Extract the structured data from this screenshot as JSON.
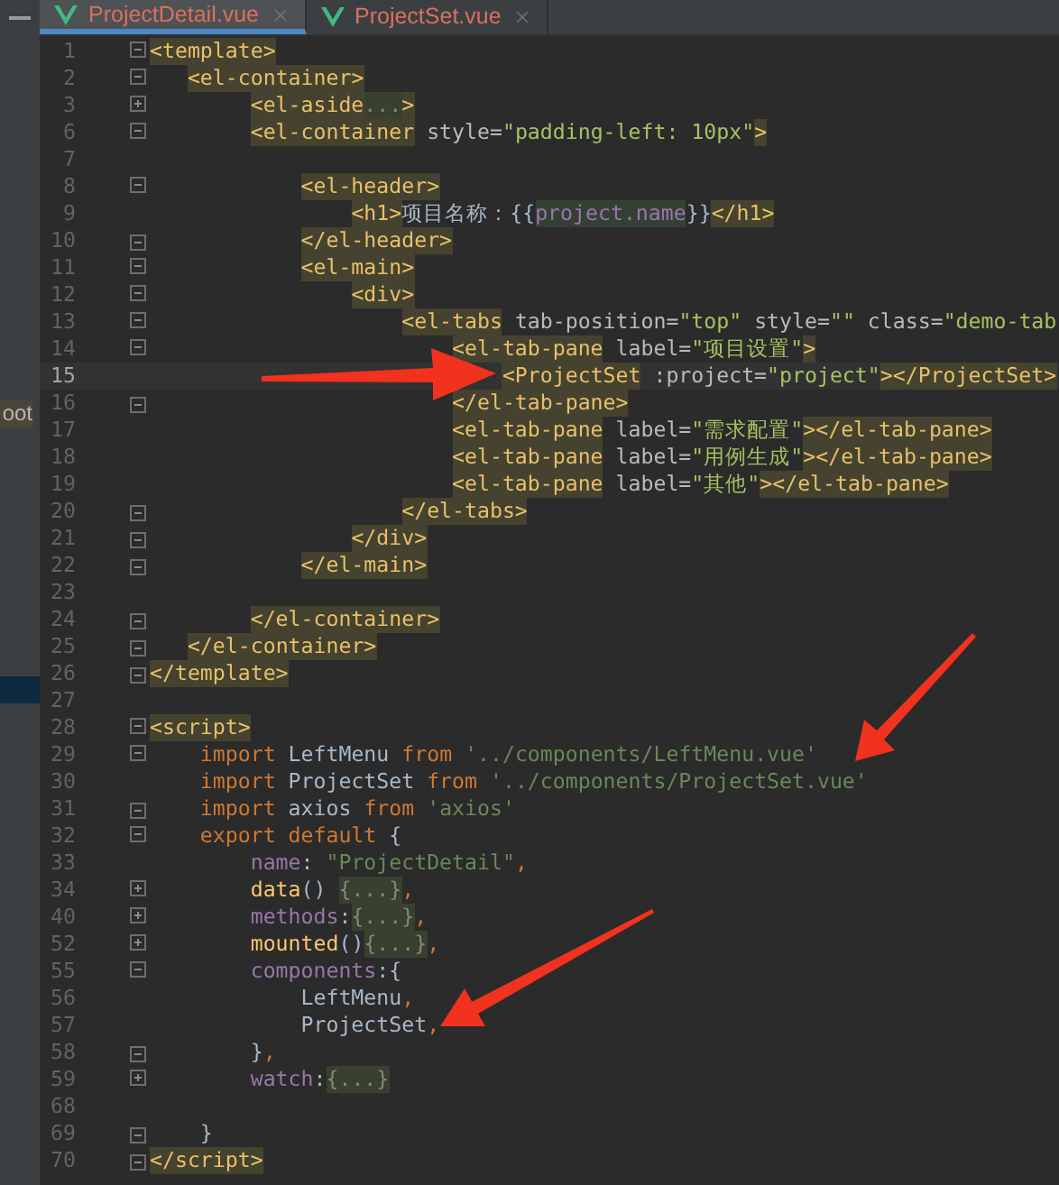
{
  "side_panel": {
    "label": "oot"
  },
  "tabs": [
    {
      "label": "ProjectDetail.vue",
      "selected": true
    },
    {
      "label": "ProjectSet.vue",
      "selected": false
    }
  ],
  "lines": [
    {
      "number": "1",
      "current": false,
      "fold": {
        "collapsed": false,
        "end": false
      },
      "tokens": [
        {
          "text": "<template>",
          "kind": "tag"
        }
      ]
    },
    {
      "number": "2",
      "current": false,
      "fold": {
        "collapsed": false,
        "end": false
      },
      "tokens": [
        {
          "text": "   <el-container>",
          "kind": "tag"
        }
      ]
    },
    {
      "number": "3",
      "current": false,
      "fold": {
        "collapsed": true,
        "end": false
      },
      "tokens": [
        {
          "text": "        <el-aside",
          "kind": "tag"
        },
        {
          "text": "...",
          "kind": "fold"
        },
        {
          "text": ">",
          "kind": "tag"
        }
      ]
    },
    {
      "number": "6",
      "current": false,
      "fold": {
        "collapsed": false,
        "end": false
      },
      "tokens": [
        {
          "text": "        <el-container",
          "kind": "tag"
        },
        {
          "text": " style=",
          "kind": "attr"
        },
        {
          "text": "\"padding-left: 10px\"",
          "kind": "string"
        },
        {
          "text": ">",
          "kind": "tag"
        }
      ]
    },
    {
      "number": "7",
      "current": false
    },
    {
      "number": "8",
      "current": false,
      "fold": {
        "collapsed": false,
        "end": false
      },
      "tokens": [
        {
          "text": "            <el-header>",
          "kind": "tag"
        }
      ]
    },
    {
      "number": "9",
      "current": false,
      "tokens": [
        {
          "text": "                <h1>",
          "kind": "tag"
        },
        {
          "text": "项目名称：{{",
          "kind": "plain"
        },
        {
          "text": "project.name",
          "kind": "var"
        },
        {
          "text": "}}",
          "kind": "plain"
        },
        {
          "text": "</h1>",
          "kind": "tag"
        }
      ]
    },
    {
      "number": "10",
      "current": false,
      "fold": {
        "collapsed": false,
        "end": true
      },
      "tokens": [
        {
          "text": "            </el-header>",
          "kind": "tag"
        }
      ]
    },
    {
      "number": "11",
      "current": false,
      "fold": {
        "collapsed": false,
        "end": false
      },
      "tokens": [
        {
          "text": "            <el-main>",
          "kind": "tag"
        }
      ]
    },
    {
      "number": "12",
      "current": false,
      "fold": {
        "collapsed": false,
        "end": false
      },
      "tokens": [
        {
          "text": "                <div>",
          "kind": "tag"
        }
      ]
    },
    {
      "number": "13",
      "current": false,
      "fold": {
        "collapsed": false,
        "end": false
      },
      "tokens": [
        {
          "text": "                    <el-tabs",
          "kind": "tag"
        },
        {
          "text": " tab-position=",
          "kind": "attr"
        },
        {
          "text": "\"top\"",
          "kind": "string"
        },
        {
          "text": " style=",
          "kind": "attr"
        },
        {
          "text": "\"\"",
          "kind": "string"
        },
        {
          "text": " class=",
          "kind": "attr"
        },
        {
          "text": "\"demo-tab",
          "kind": "string"
        }
      ]
    },
    {
      "number": "14",
      "current": false,
      "fold": {
        "collapsed": false,
        "end": false
      },
      "tokens": [
        {
          "text": "                        <el-tab-pane",
          "kind": "tag"
        },
        {
          "text": " label=",
          "kind": "attr"
        },
        {
          "text": "\"项目设置\"",
          "kind": "string"
        },
        {
          "text": ">",
          "kind": "tag"
        }
      ]
    },
    {
      "number": "15",
      "current": true,
      "tokens": [
        {
          "text": "                            <ProjectSet",
          "kind": "tag"
        },
        {
          "text": " :project=",
          "kind": "attr"
        },
        {
          "text": "\"project\"",
          "kind": "string"
        },
        {
          "text": "></ProjectSet>",
          "kind": "tag"
        }
      ]
    },
    {
      "number": "16",
      "current": false,
      "fold": {
        "collapsed": false,
        "end": true
      },
      "tokens": [
        {
          "text": "                        </el-tab-pane>",
          "kind": "tag"
        }
      ]
    },
    {
      "number": "17",
      "current": false,
      "tokens": [
        {
          "text": "                        <el-tab-pane",
          "kind": "tag"
        },
        {
          "text": " label=",
          "kind": "attr"
        },
        {
          "text": "\"需求配置\"",
          "kind": "string"
        },
        {
          "text": "></el-tab-pane>",
          "kind": "tag"
        }
      ]
    },
    {
      "number": "18",
      "current": false,
      "tokens": [
        {
          "text": "                        <el-tab-pane",
          "kind": "tag"
        },
        {
          "text": " label=",
          "kind": "attr"
        },
        {
          "text": "\"用例生成\"",
          "kind": "string"
        },
        {
          "text": "></el-tab-pane>",
          "kind": "tag"
        }
      ]
    },
    {
      "number": "19",
      "current": false,
      "tokens": [
        {
          "text": "                        <el-tab-pane",
          "kind": "tag"
        },
        {
          "text": " label=",
          "kind": "attr"
        },
        {
          "text": "\"其他\"",
          "kind": "string"
        },
        {
          "text": "></el-tab-pane>",
          "kind": "tag"
        }
      ]
    },
    {
      "number": "20",
      "current": false,
      "fold": {
        "collapsed": false,
        "end": true
      },
      "tokens": [
        {
          "text": "                    </el-tabs>",
          "kind": "tag"
        }
      ]
    },
    {
      "number": "21",
      "current": false,
      "fold": {
        "collapsed": false,
        "end": true
      },
      "tokens": [
        {
          "text": "                </div>",
          "kind": "tag"
        }
      ]
    },
    {
      "number": "22",
      "current": false,
      "fold": {
        "collapsed": false,
        "end": true
      },
      "tokens": [
        {
          "text": "            </el-main>",
          "kind": "tag"
        }
      ]
    },
    {
      "number": "23",
      "current": false
    },
    {
      "number": "24",
      "current": false,
      "fold": {
        "collapsed": false,
        "end": true
      },
      "tokens": [
        {
          "text": "        </el-container>",
          "kind": "tag"
        }
      ]
    },
    {
      "number": "25",
      "current": false,
      "fold": {
        "collapsed": false,
        "end": true
      },
      "tokens": [
        {
          "text": "   </el-container>",
          "kind": "tag"
        }
      ]
    },
    {
      "number": "26",
      "current": false,
      "fold": {
        "collapsed": false,
        "end": true
      },
      "tokens": [
        {
          "text": "</template>",
          "kind": "tag"
        }
      ]
    },
    {
      "number": "27",
      "current": false
    },
    {
      "number": "28",
      "current": false,
      "fold": {
        "collapsed": false,
        "end": false
      },
      "tokens": [
        {
          "text": "<script>",
          "kind": "tag"
        }
      ]
    },
    {
      "number": "29",
      "current": false,
      "fold": {
        "collapsed": false,
        "end": false
      },
      "tokens": [
        {
          "text": "    import",
          "kind": "keyword"
        },
        {
          "text": " LeftMenu ",
          "kind": "plain"
        },
        {
          "text": "from",
          "kind": "keyword"
        },
        {
          "text": " '../components/LeftMenu.vue'",
          "kind": "literal"
        }
      ]
    },
    {
      "number": "30",
      "current": false,
      "tokens": [
        {
          "text": "    import",
          "kind": "keyword"
        },
        {
          "text": " ProjectSet ",
          "kind": "plain"
        },
        {
          "text": "from",
          "kind": "keyword"
        },
        {
          "text": " '../components/ProjectSet.vue'",
          "kind": "literal"
        }
      ]
    },
    {
      "number": "31",
      "current": false,
      "fold": {
        "collapsed": false,
        "end": true
      },
      "tokens": [
        {
          "text": "    import",
          "kind": "keyword"
        },
        {
          "text": " axios ",
          "kind": "plain"
        },
        {
          "text": "from",
          "kind": "keyword"
        },
        {
          "text": " 'axios'",
          "kind": "literal"
        }
      ]
    },
    {
      "number": "32",
      "current": false,
      "fold": {
        "collapsed": false,
        "end": false
      },
      "tokens": [
        {
          "text": "    export default",
          "kind": "keyword"
        },
        {
          "text": " {",
          "kind": "plain"
        }
      ]
    },
    {
      "number": "33",
      "current": false,
      "tokens": [
        {
          "text": "        name",
          "kind": "prop"
        },
        {
          "text": ": ",
          "kind": "plain"
        },
        {
          "text": "\"ProjectDetail\"",
          "kind": "literal"
        },
        {
          "text": ",",
          "kind": "keyword"
        }
      ]
    },
    {
      "number": "34",
      "current": false,
      "fold": {
        "collapsed": true,
        "end": false
      },
      "tokens": [
        {
          "text": "        data",
          "kind": "func"
        },
        {
          "text": "() ",
          "kind": "plain"
        },
        {
          "text": "{...}",
          "kind": "fold"
        },
        {
          "text": ",",
          "kind": "keyword"
        }
      ]
    },
    {
      "number": "40",
      "current": false,
      "fold": {
        "collapsed": true,
        "end": false
      },
      "tokens": [
        {
          "text": "        methods",
          "kind": "prop"
        },
        {
          "text": ":",
          "kind": "plain"
        },
        {
          "text": "{...}",
          "kind": "fold"
        },
        {
          "text": ",",
          "kind": "keyword"
        }
      ]
    },
    {
      "number": "52",
      "current": false,
      "fold": {
        "collapsed": true,
        "end": false
      },
      "tokens": [
        {
          "text": "        mounted",
          "kind": "func"
        },
        {
          "text": "()",
          "kind": "plain"
        },
        {
          "text": "{...}",
          "kind": "fold"
        },
        {
          "text": ",",
          "kind": "keyword"
        }
      ]
    },
    {
      "number": "55",
      "current": false,
      "fold": {
        "collapsed": false,
        "end": false
      },
      "tokens": [
        {
          "text": "        components",
          "kind": "prop"
        },
        {
          "text": ":{",
          "kind": "plain"
        }
      ]
    },
    {
      "number": "56",
      "current": false,
      "tokens": [
        {
          "text": "            LeftMenu",
          "kind": "plain"
        },
        {
          "text": ",",
          "kind": "keyword"
        }
      ]
    },
    {
      "number": "57",
      "current": false,
      "tokens": [
        {
          "text": "            ProjectSet",
          "kind": "plain"
        },
        {
          "text": ",",
          "kind": "keyword"
        }
      ]
    },
    {
      "number": "58",
      "current": false,
      "fold": {
        "collapsed": false,
        "end": true
      },
      "tokens": [
        {
          "text": "        }",
          "kind": "plain"
        },
        {
          "text": ",",
          "kind": "keyword"
        }
      ]
    },
    {
      "number": "59",
      "current": false,
      "fold": {
        "collapsed": true,
        "end": false
      },
      "tokens": [
        {
          "text": "        watch",
          "kind": "prop"
        },
        {
          "text": ":",
          "kind": "plain"
        },
        {
          "text": "{...}",
          "kind": "fold"
        }
      ]
    },
    {
      "number": "68",
      "current": false
    },
    {
      "number": "69",
      "current": false,
      "fold": {
        "collapsed": false,
        "end": true
      },
      "tokens": [
        {
          "text": "    }",
          "kind": "plain"
        }
      ]
    },
    {
      "number": "70",
      "current": false,
      "fold": {
        "collapsed": false,
        "end": true
      },
      "tokens": [
        {
          "text": "</script>",
          "kind": "tag"
        }
      ]
    }
  ]
}
